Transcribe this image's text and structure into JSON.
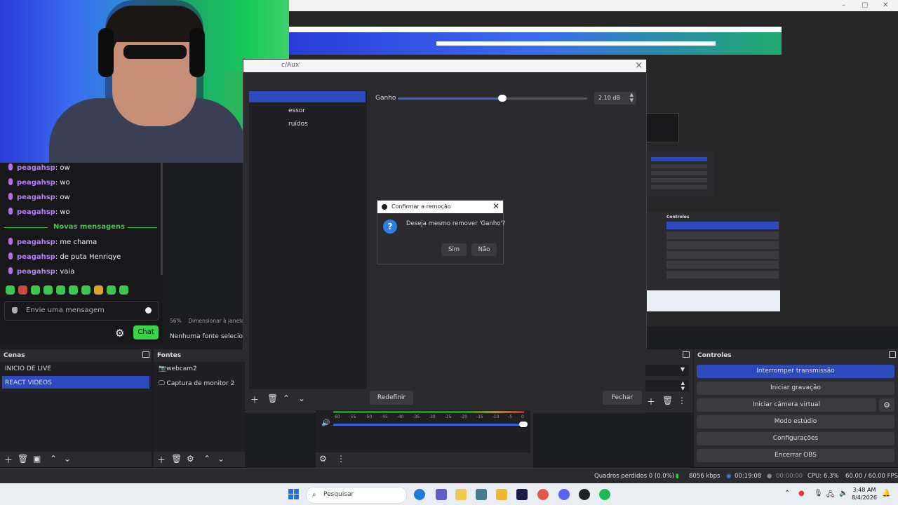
{
  "filters_dialog": {
    "title": "c/Aux'",
    "left_items": [
      "essor",
      "ruídos"
    ],
    "gain_label": "Ganho",
    "gain_value": "2.10 dB",
    "gain_fraction": 0.55,
    "reset_label": "Redefinir",
    "close_label": "Fechar"
  },
  "modal": {
    "title": "Confirmar a remoção",
    "message": "Deseja mesmo remover 'Ganho'?",
    "yes_label": "Sim",
    "no_label": "Não"
  },
  "chat": {
    "messages_top": [
      {
        "user": "peagahsp",
        "text": ": ow"
      },
      {
        "user": "peagahsp",
        "text": ": wo"
      },
      {
        "user": "peagahsp",
        "text": ": ow"
      },
      {
        "user": "peagahsp",
        "text": ": wo"
      }
    ],
    "new_messages_label": "Novas mensagens",
    "messages_bottom": [
      {
        "user": "peagahsp",
        "text": ": me chama"
      },
      {
        "user": "peagahsp",
        "text": ": de puta Henriqye"
      },
      {
        "user": "peagahsp",
        "text": ": vaia"
      }
    ],
    "input_placeholder": "Envie uma mensagem",
    "chat_button": "Chat"
  },
  "canvas": {
    "zoom": "56%",
    "zoom_mode": "Dimensionar à janela",
    "no_source": "Nenhuma fonte selecionac"
  },
  "scenes": {
    "title": "Cenas",
    "items": [
      "INICIO DE LIVE",
      "REACT VIDEOS"
    ],
    "selected": 1
  },
  "sources": {
    "title": "Fontes",
    "items": [
      "webcam2",
      "Captura de monitor 2"
    ]
  },
  "controls": {
    "title": "Controles",
    "buttons": [
      "Interromper transmissão",
      "Iniciar gravação",
      "Iniciar câmera virtual",
      "Modo estúdio",
      "Configurações",
      "Encerrar OBS"
    ]
  },
  "mixer": {
    "scale": [
      "-60",
      "-55",
      "-50",
      "-45",
      "-40",
      "-35",
      "-30",
      "-25",
      "-20",
      "-15",
      "-10",
      "-5",
      "0"
    ]
  },
  "status": {
    "dropped": "Quadros perdidos 0 (0.0%)",
    "bitrate": "8056 kbps",
    "stream_time": "00:19:08",
    "rec_time": "00:00:00",
    "cpu": "CPU: 6.3%",
    "fps": "60.00 / 60.00 FPS"
  },
  "taskbar": {
    "search_placeholder": "Pesquisar",
    "time": "3:48 AM",
    "date": "8/4/2026"
  },
  "colors": {
    "accent": "#2e4bbd",
    "chat_green": "#3bd24a",
    "username": "#b47ff7"
  }
}
